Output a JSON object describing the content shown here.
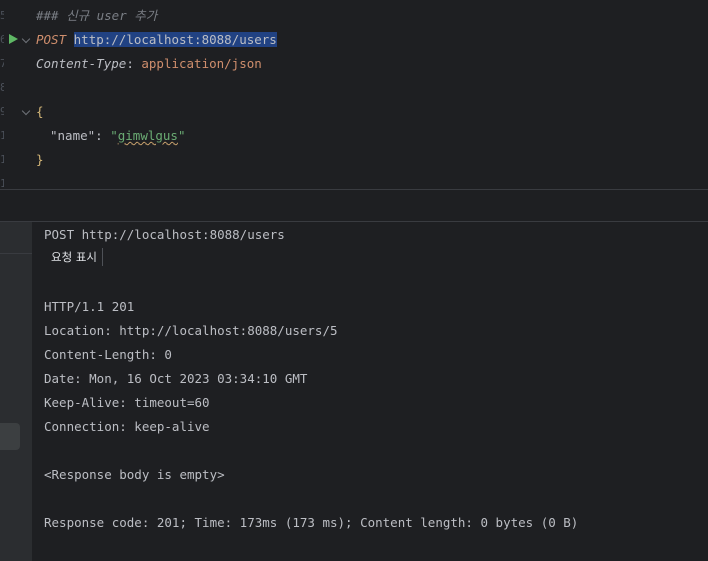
{
  "editor": {
    "comment": "### 신규 user 추가",
    "method": "POST",
    "url": "http://localhost:8088/users",
    "header_name": "Content-Type",
    "header_sep": ": ",
    "header_value": "application/json",
    "brace_open": "{",
    "json_key": "\"name\"",
    "json_colon": ": ",
    "json_value": "\"gimwlgus\"",
    "brace_close": "}"
  },
  "response": {
    "request_line": "POST http://localhost:8088/users",
    "show_request_label": "요청 표시",
    "lines": [
      "HTTP/1.1 201",
      "Location: http://localhost:8088/users/5",
      "Content-Length: 0",
      "Date: Mon, 16 Oct 2023 03:34:10 GMT",
      "Keep-Alive: timeout=60",
      "Connection: keep-alive"
    ],
    "body_note": "<Response body is empty>",
    "summary": "Response code: 201; Time: 173ms (173 ms); Content length: 0 bytes (0 B)"
  },
  "icons": {
    "run": "run-icon",
    "fold": "chevron-down-icon"
  },
  "colors": {
    "background": "#1e1f22",
    "selection": "#214283",
    "run_green": "#5fb865",
    "string_green": "#6aab73",
    "keyword_orange": "#cf8e6d"
  }
}
